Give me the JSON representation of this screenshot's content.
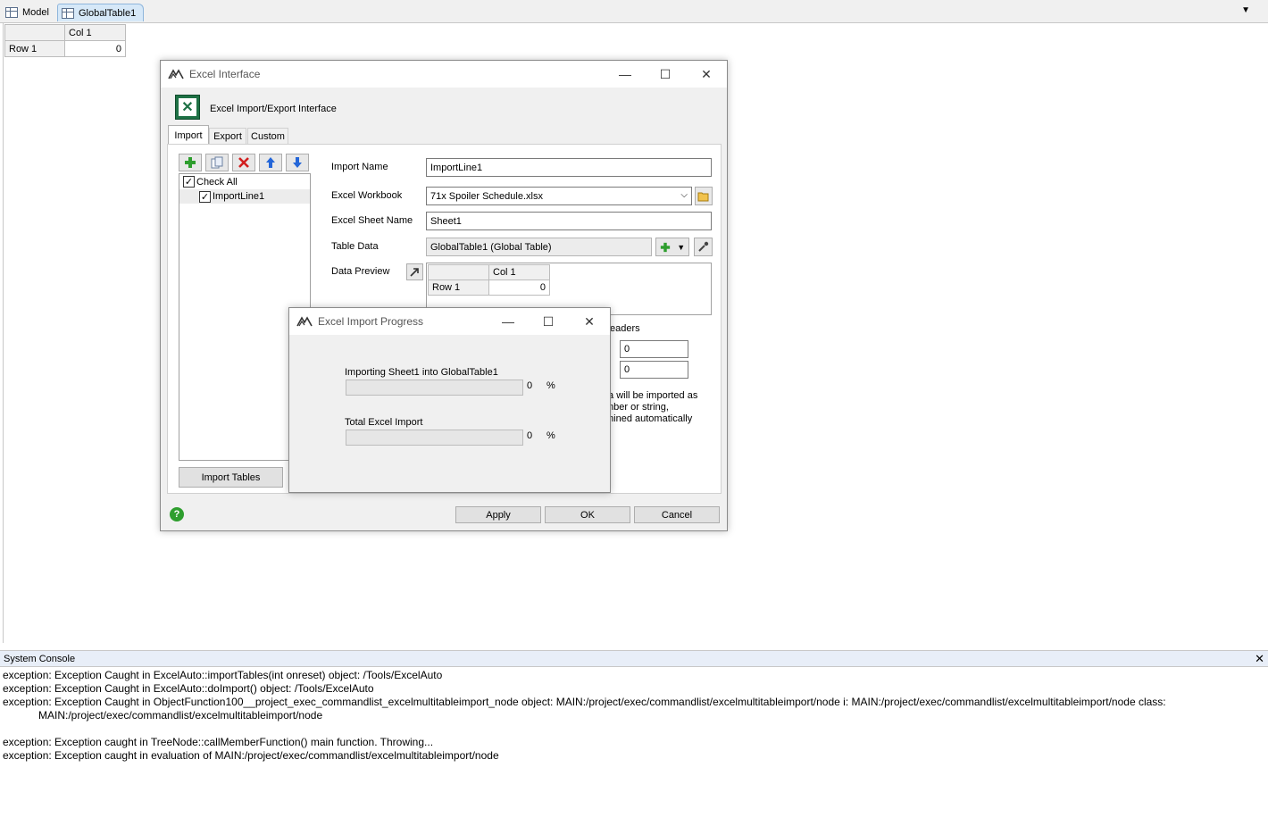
{
  "tabs": [
    {
      "label": "Model"
    },
    {
      "label": "GlobalTable1"
    }
  ],
  "main_table": {
    "col_header": "Col 1",
    "row_header": "Row 1",
    "value": "0"
  },
  "excel_dialog": {
    "title": "Excel Interface",
    "header": "Excel Import/Export Interface",
    "tabs": [
      "Import",
      "Export",
      "Custom"
    ],
    "check_all": "Check All",
    "list_items": [
      "ImportLine1"
    ],
    "import_name_label": "Import Name",
    "import_name_value": "ImportLine1",
    "workbook_label": "Excel Workbook",
    "workbook_value": "71x Spoiler Schedule.xlsx",
    "sheet_label": "Excel Sheet Name",
    "sheet_value": "Sheet1",
    "table_label": "Table Data",
    "table_value": "GlobalTable1 (Global Table)",
    "preview_label": "Data Preview",
    "preview": {
      "col_header": "Col 1",
      "row_header": "Row 1",
      "value": "0"
    },
    "headers_fragment": "eaders",
    "start_row_value": "0",
    "start_col_value": "0",
    "note_lines": [
      "ta will be imported as",
      "mber or string,",
      "mined automatically"
    ],
    "import_tables_label": "Import Tables",
    "apply_label": "Apply",
    "ok_label": "OK",
    "cancel_label": "Cancel"
  },
  "progress_dialog": {
    "title": "Excel Import Progress",
    "sheet_label": "Importing Sheet1 into GlobalTable1",
    "sheet_percent": "0",
    "total_label": "Total Excel Import",
    "total_percent": "0",
    "percent_sign": "%"
  },
  "console": {
    "title": "System Console",
    "lines": [
      "exception: Exception Caught in ExcelAuto::importTables(int onreset) object: /Tools/ExcelAuto",
      "exception: Exception Caught in ExcelAuto::doImport() object: /Tools/ExcelAuto",
      "exception: Exception Caught in ObjectFunction100__project_exec_commandlist_excelmultitableimport_node object: MAIN:/project/exec/commandlist/excelmultitableimport/node i: MAIN:/project/exec/commandlist/excelmultitableimport/node class:",
      "MAIN:/project/exec/commandlist/excelmultitableimport/node",
      "",
      "exception: Exception caught in TreeNode::callMemberFunction() main function. Throwing...",
      "exception: Exception caught in evaluation of MAIN:/project/exec/commandlist/excelmultitableimport/node"
    ]
  },
  "colors": {
    "accent": "#d6e8f8",
    "dialog_bg": "#f0f0f0",
    "excel_green": "#1e7145",
    "add_green": "#2e9e2e",
    "delete_red": "#d21f1f",
    "arrow_blue": "#2466d8"
  }
}
